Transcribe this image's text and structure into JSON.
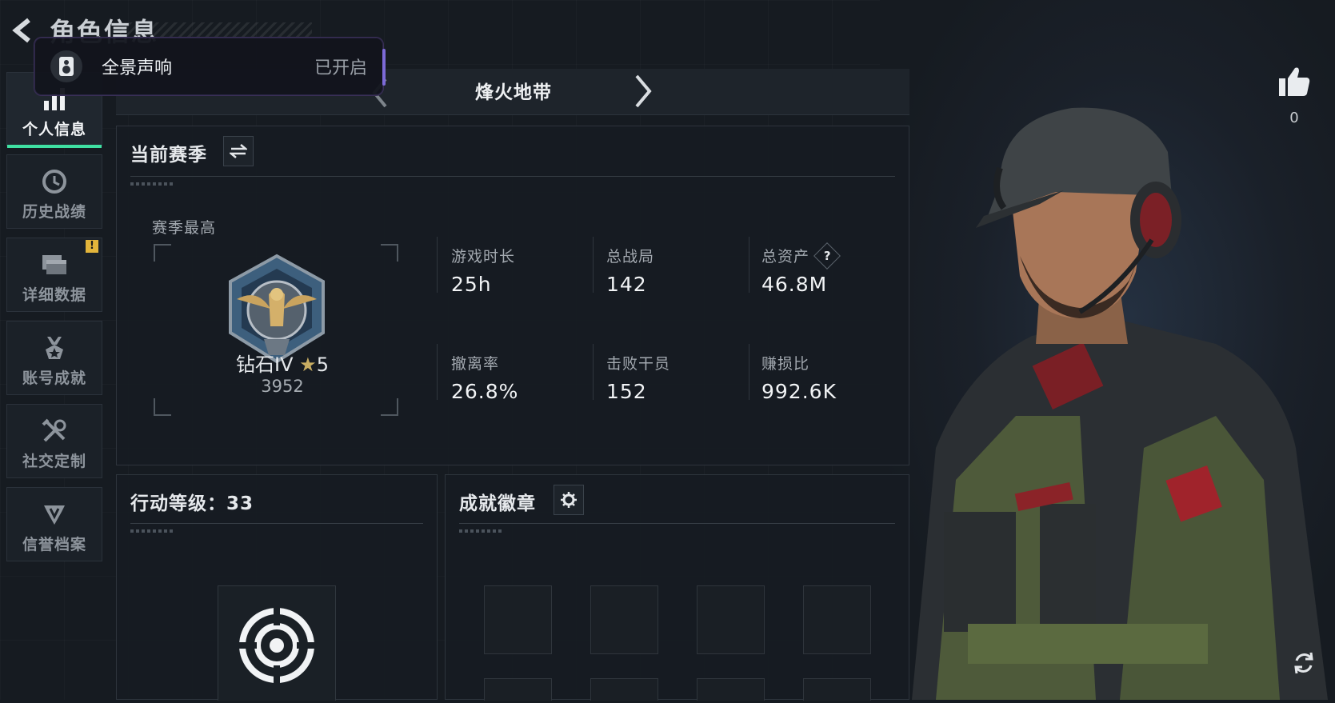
{
  "header": {
    "title": "角色信息"
  },
  "toast": {
    "label": "全景声响",
    "status": "已开启"
  },
  "sidebar": {
    "items": [
      {
        "label": "个人信息",
        "icon": "bar-chart-icon",
        "active": true
      },
      {
        "label": "历史战绩",
        "icon": "clock-icon",
        "active": false
      },
      {
        "label": "详细数据",
        "icon": "folder-icon",
        "active": false,
        "badge": "!"
      },
      {
        "label": "账号成就",
        "icon": "medal-icon",
        "active": false
      },
      {
        "label": "社交定制",
        "icon": "tools-icon",
        "active": false
      },
      {
        "label": "信誉档案",
        "icon": "shield-icon",
        "active": false
      }
    ]
  },
  "mode": {
    "name": "烽火地带"
  },
  "season": {
    "title": "当前赛季",
    "best_label": "赛季最高",
    "rank_name": "钻石IV",
    "rank_stars": "5",
    "rank_points": "3952",
    "stats": [
      {
        "label": "游戏时长",
        "value": "25h"
      },
      {
        "label": "总战局",
        "value": "142"
      },
      {
        "label": "总资产",
        "value": "46.8M",
        "help": "?"
      },
      {
        "label": "撤离率",
        "value": "26.8%"
      },
      {
        "label": "击败干员",
        "value": "152"
      },
      {
        "label": "赚损比",
        "value": "992.6K"
      }
    ]
  },
  "level": {
    "title": "行动等级：33"
  },
  "achievements": {
    "title": "成就徽章"
  },
  "likes": {
    "count": "0"
  },
  "colors": {
    "accent_green": "#3fe0a2",
    "badge_yellow": "#e3b53b",
    "toast_border": "#7c6ad7"
  }
}
